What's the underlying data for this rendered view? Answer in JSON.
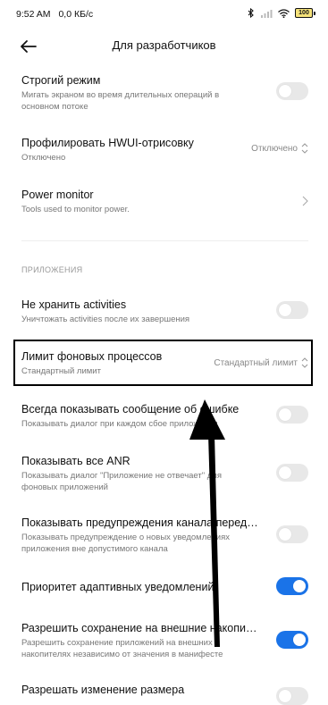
{
  "status_bar": {
    "time": "9:52 AM",
    "speed": "0,0 КБ/с",
    "battery": "100",
    "icons": [
      "bluetooth-icon",
      "signal-icon",
      "wifi-icon",
      "battery-icon"
    ]
  },
  "header": {
    "title": "Для разработчиков",
    "back_icon": "arrow-left-icon"
  },
  "rows": {
    "strict_mode": {
      "title": "Строгий режим",
      "subtitle": "Мигать экраном во время длительных операций в основном потоке",
      "enabled": false
    },
    "hwui": {
      "title": "Профилировать HWUI-отрисовку",
      "subtitle": "Отключено",
      "value": "Отключено"
    },
    "power_monitor": {
      "title": "Power monitor",
      "subtitle": "Tools used to monitor power."
    },
    "section": "ПРИЛОЖЕНИЯ",
    "dont_keep": {
      "title": "Не хранить activities",
      "subtitle": "Уничтожать activities после их завершения",
      "enabled": false
    },
    "bg_limit": {
      "title": "Лимит фоновых процессов",
      "subtitle": "Стандартный лимит",
      "value": "Стандартный лимит"
    },
    "show_crash": {
      "title": "Всегда показывать сообщение об ошибке",
      "subtitle": "Показывать диалог при каждом сбое приложения",
      "enabled": false
    },
    "show_anr": {
      "title": "Показывать все ANR",
      "subtitle": "Показывать диалог \"Приложение не отвечает\" для фоновых приложений",
      "enabled": false
    },
    "channel_warn": {
      "title": "Показывать предупреждения канала передачи",
      "subtitle": "Показывать предупреждение о новых уведомлениях приложения вне допустимого канала",
      "enabled": false
    },
    "adaptive_notif": {
      "title": "Приоритет адаптивных уведомлений",
      "enabled": true
    },
    "external_storage": {
      "title": "Разрешить сохранение на внешние накопители",
      "subtitle": "Разрешить сохранение приложений на внешних накопителях независимо от значения в манифесте",
      "enabled": true
    },
    "resize": {
      "title": "Разрешать изменение размера"
    }
  },
  "colors": {
    "accent": "#1a73e8",
    "toggle_off": "#e8e8e8",
    "annotation": "#000000"
  }
}
